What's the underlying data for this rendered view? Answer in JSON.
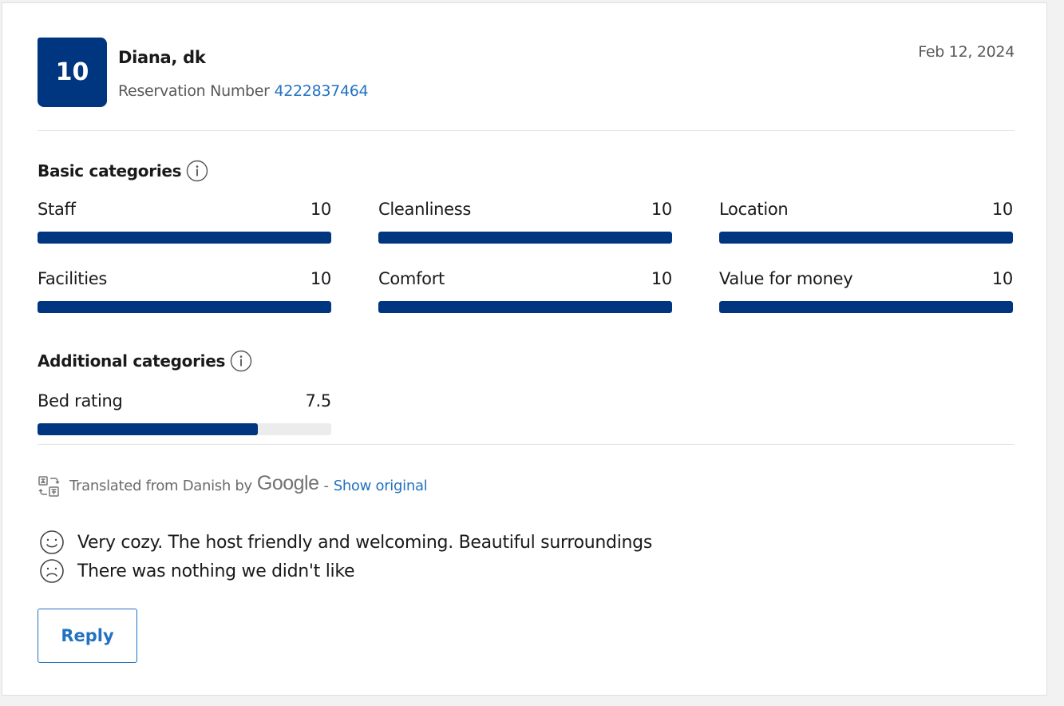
{
  "review": {
    "score": "10",
    "reviewer_name": "Diana, dk",
    "reservation_label": "Reservation Number",
    "reservation_number": "4222837464",
    "date": "Feb 12, 2024"
  },
  "basic_categories": {
    "title": "Basic categories",
    "items": [
      {
        "label": "Staff",
        "value": "10",
        "fraction": 1.0
      },
      {
        "label": "Cleanliness",
        "value": "10",
        "fraction": 1.0
      },
      {
        "label": "Location",
        "value": "10",
        "fraction": 1.0
      },
      {
        "label": "Facilities",
        "value": "10",
        "fraction": 1.0
      },
      {
        "label": "Comfort",
        "value": "10",
        "fraction": 1.0
      },
      {
        "label": "Value for money",
        "value": "10",
        "fraction": 1.0
      }
    ]
  },
  "additional_categories": {
    "title": "Additional categories",
    "items": [
      {
        "label": "Bed rating",
        "value": "7.5",
        "fraction": 0.75
      }
    ]
  },
  "translation": {
    "prefix": "Translated from Danish by",
    "provider": "Google",
    "separator": "-",
    "show_original": "Show original"
  },
  "comments": {
    "positive": "Very cozy. The host friendly and welcoming. Beautiful surroundings",
    "negative": "There was nothing we didn't like"
  },
  "actions": {
    "reply_label": "Reply"
  },
  "colors": {
    "brand": "#003580",
    "link": "#2272c1",
    "track": "#ececec"
  },
  "icons": [
    "info-icon",
    "translate-icon",
    "smiley-icon",
    "sad-face-icon"
  ]
}
